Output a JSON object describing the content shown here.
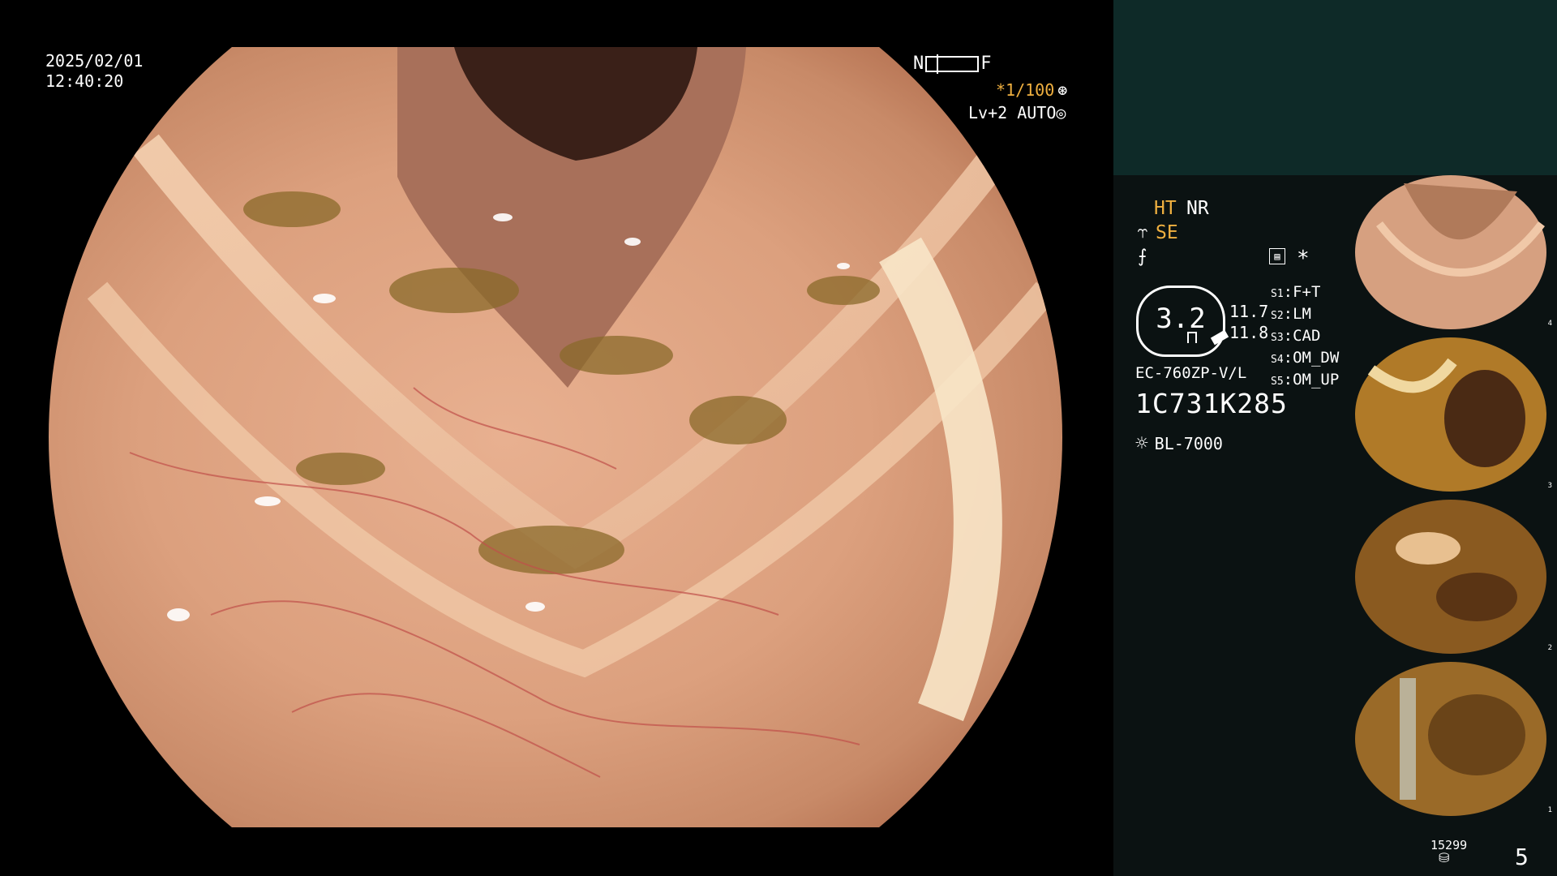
{
  "osd": {
    "date": "2025/02/01",
    "time": "12:40:20",
    "near_label": "N",
    "far_label": "F",
    "shutter": "*1/100",
    "iris": "Lv+2 AUTO"
  },
  "panel": {
    "ht": "HT",
    "nr": "NR",
    "se": "SE",
    "scope_value": "3.2",
    "val_1": "11.7",
    "val_2": "11.8",
    "model": "EC-760ZP-V/L",
    "serial": "1C731K285",
    "light_source": "BL-7000",
    "switches": [
      {
        "key": "S1",
        "label": "F+T"
      },
      {
        "key": "S2",
        "label": "LM"
      },
      {
        "key": "S3",
        "label": "CAD"
      },
      {
        "key": "S4",
        "label": "OM_DW"
      },
      {
        "key": "S5",
        "label": "OM_UP"
      }
    ],
    "thumbnail_numbers": [
      "4",
      "3",
      "2",
      "1"
    ],
    "image_count": "15299",
    "page": "5"
  },
  "colors": {
    "accent": "#f0b040",
    "panel_bg": "#0b1212",
    "panel_top": "#0e2a28"
  },
  "icons": [
    "shutter-icon",
    "iris-icon",
    "se-icon",
    "freeze-icon",
    "grid-icon",
    "star-icon",
    "light-icon",
    "disk-icon"
  ]
}
